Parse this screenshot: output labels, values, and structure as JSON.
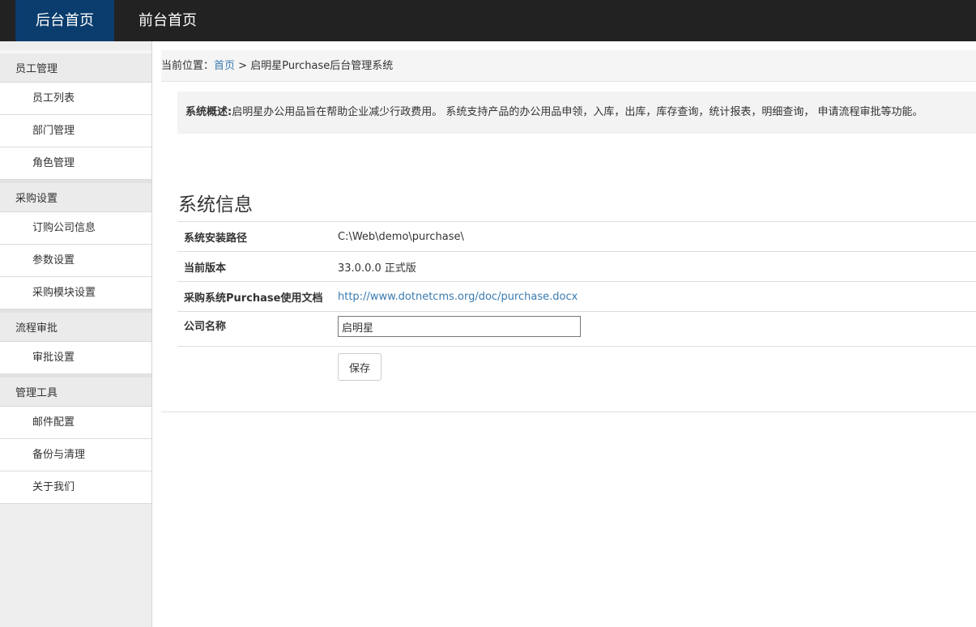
{
  "topnav": {
    "tabs": [
      {
        "label": "后台首页",
        "active": true
      },
      {
        "label": "前台首页",
        "active": false
      }
    ]
  },
  "sidebar": {
    "groups": [
      {
        "title": "员工管理",
        "items": [
          "员工列表",
          "部门管理",
          "角色管理"
        ]
      },
      {
        "title": "采购设置",
        "items": [
          "订购公司信息",
          "参数设置",
          "采购模块设置"
        ]
      },
      {
        "title": "流程审批",
        "items": [
          "审批设置"
        ]
      },
      {
        "title": "管理工具",
        "items": [
          "邮件配置",
          "备份与清理",
          "关于我们"
        ]
      }
    ]
  },
  "breadcrumb": {
    "prefix": "当前位置：",
    "home": "首页",
    "separator": " > ",
    "current": "启明星Purchase后台管理系统"
  },
  "notice": {
    "label": "系统概述:",
    "text": "启明星办公用品旨在帮助企业减少行政费用。 系统支持产品的办公用品申领，入库，出库，库存查询，统计报表，明细查询， 申请流程审批等功能。"
  },
  "system_info": {
    "title": "系统信息",
    "install_path_label": "系统安装路径",
    "install_path": "C:\\Web\\demo\\purchase\\",
    "version_label": "当前版本",
    "version": "33.0.0.0 正式版",
    "doc_label": "采购系统Purchase使用文档",
    "doc_url": "http://www.dotnetcms.org/doc/purchase.docx",
    "company_label": "公司名称",
    "company_value": "启明星",
    "save_label": "保存"
  },
  "colors": {
    "topbar": "#222222",
    "active_tab": "#0a3d6e",
    "link": "#3a7bb0"
  }
}
